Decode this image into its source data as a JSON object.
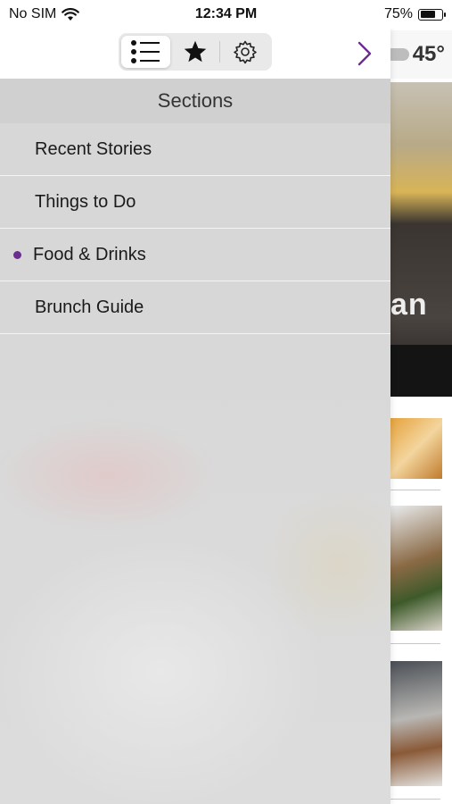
{
  "status_bar": {
    "carrier": "No SIM",
    "time": "12:34 PM",
    "battery_percent": "75%",
    "battery_level": 0.75
  },
  "background_app": {
    "weather_temp": "45°",
    "hero_text_fragment": "an"
  },
  "drawer": {
    "tabs": [
      {
        "icon": "list-icon",
        "selected": true
      },
      {
        "icon": "star-icon",
        "selected": false
      },
      {
        "icon": "gear-icon",
        "selected": false
      }
    ],
    "close_icon": "chevron-right-icon",
    "sections_title": "Sections",
    "items": [
      {
        "label": "Recent Stories",
        "active": false
      },
      {
        "label": "Things to Do",
        "active": false
      },
      {
        "label": "Food & Drinks",
        "active": true
      },
      {
        "label": "Brunch Guide",
        "active": false
      }
    ]
  },
  "colors": {
    "accent": "#6b2d8f",
    "active_dot": "#6b2d8f"
  }
}
